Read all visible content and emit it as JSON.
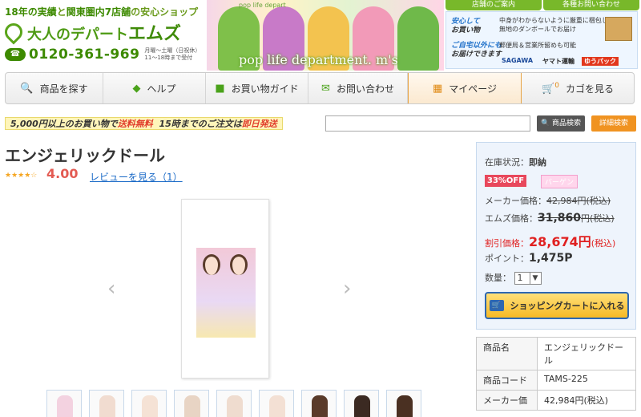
{
  "header": {
    "slogan_prefix": "18年の実績",
    "slogan_mid": "と",
    "slogan_region": "関東圏内7店舗",
    "slogan_suffix": "の安心ショップ",
    "logo_small": "大人のデパート",
    "logo_big": "エムズ",
    "phone": "0120-361-969",
    "hours_line1": "月曜～土曜（日祝休）",
    "hours_line2": "11～18時まで受付",
    "banner_text": "pop life department. m's",
    "banner_sub": "pop life depart",
    "store_tabs": [
      "店舗のご案内",
      "各種お問い合わせ"
    ],
    "info": {
      "label1": "安心して",
      "label1b": "お買い物",
      "desc1a": "中身がわからないように厳重に梱包した上、",
      "desc1b": "無地のダンボールでお届け",
      "label2": "ご自宅以外にも",
      "label2b": "お届けできます",
      "desc2": "郵便局＆営業所留めも可能",
      "carriers": [
        "SAGAWA",
        "ヤマト運輸",
        "ゆうパック"
      ]
    }
  },
  "nav": {
    "items": [
      {
        "label": "商品を探す",
        "icon": "search-icon"
      },
      {
        "label": "ヘルプ",
        "icon": "beginner-icon"
      },
      {
        "label": "お買い物ガイド",
        "icon": "bag-icon"
      },
      {
        "label": "お問い合わせ",
        "icon": "mail-icon"
      },
      {
        "label": "マイページ",
        "icon": "calendar-icon"
      },
      {
        "label": "カゴを見る",
        "icon": "cart-icon"
      }
    ],
    "cart_count": "0"
  },
  "promo": {
    "part1": "5,000円以上のお買い物で",
    "part2": "送料無料",
    "part3": "15時までのご注文は",
    "part4": "即日発送"
  },
  "search": {
    "placeholder": "",
    "button": "商品検索",
    "advanced": "詳細検索"
  },
  "product": {
    "title": "エンジェリックドール",
    "stars": "★★★★☆",
    "rating": "4.00",
    "review_link": "レビューを見る（1）",
    "thumb_count": 9
  },
  "side": {
    "stock_label": "在庫状況：",
    "stock_value": "即納",
    "discount_badge": "33%OFF",
    "bargain_badge": "バーゲン",
    "maker_label": "メーカー価格：",
    "maker_price": "42,984円(税込)",
    "ems_label": "エムズ価格：",
    "ems_price": "31,860",
    "ems_suffix": "円(税込)",
    "sale_label": "割引価格：",
    "sale_price": "28,674円",
    "sale_suffix": "(税込)",
    "point_label": "ポイント：",
    "point_value": "1,475P",
    "qty_label": "数量：",
    "qty_value": "1",
    "cart_button": "ショッピングカートに入れる"
  },
  "spec": {
    "rows": [
      {
        "key": "商品名",
        "value": "エンジェリックドール"
      },
      {
        "key": "商品コード",
        "value": "TAMS-225"
      },
      {
        "key": "メーカー価",
        "value": "42,984円(税込)"
      }
    ]
  }
}
